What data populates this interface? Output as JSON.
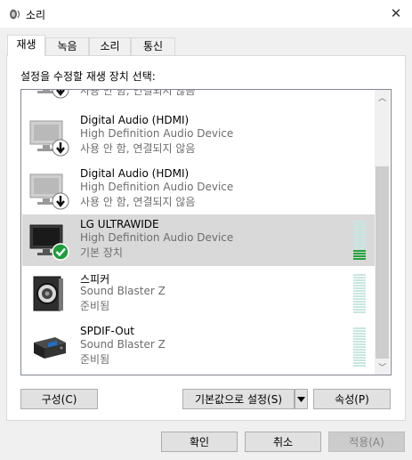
{
  "window": {
    "title": "소리"
  },
  "tabs": [
    {
      "label": "재생",
      "active": true
    },
    {
      "label": "녹음",
      "active": false
    },
    {
      "label": "소리",
      "active": false
    },
    {
      "label": "통신",
      "active": false
    }
  ],
  "instruction": "설정을 수정할 재생 장치 선택:",
  "devices": [
    {
      "name": "",
      "description": "",
      "status": "사용 안 함, 연결되지 않음",
      "icon": "monitor-icon",
      "badge": "arrow-down-icon",
      "selected": false
    },
    {
      "name": "Digital Audio (HDMI)",
      "description": "High Definition Audio Device",
      "status": "사용 안 함, 연결되지 않음",
      "icon": "monitor-icon",
      "badge": "arrow-down-icon",
      "selected": false
    },
    {
      "name": "Digital Audio (HDMI)",
      "description": "High Definition Audio Device",
      "status": "사용 안 함, 연결되지 않음",
      "icon": "monitor-icon",
      "badge": "arrow-down-icon",
      "selected": false
    },
    {
      "name": "LG ULTRAWIDE",
      "description": "High Definition Audio Device",
      "status": "기본 장치",
      "icon": "monitor-icon",
      "badge": "check-icon",
      "selected": true,
      "level": 0.25
    },
    {
      "name": "스피커",
      "description": "Sound Blaster Z",
      "status": "준비됨",
      "icon": "speaker-icon",
      "selected": false,
      "level": 0
    },
    {
      "name": "SPDIF-Out",
      "description": "Sound Blaster Z",
      "status": "준비됨",
      "icon": "spdif-device-icon",
      "selected": false,
      "level": 0
    }
  ],
  "buttons": {
    "configure": "구성(C)",
    "set_default": "기본값으로 설정(S)",
    "properties": "속성(P)",
    "ok": "확인",
    "cancel": "취소",
    "apply": "적용(A)"
  },
  "colors": {
    "selected_row": "#d9d9d9",
    "meter_active": "#23a33c",
    "meter_idle": "#c8e6e1",
    "check_badge": "#1e9e3c"
  }
}
